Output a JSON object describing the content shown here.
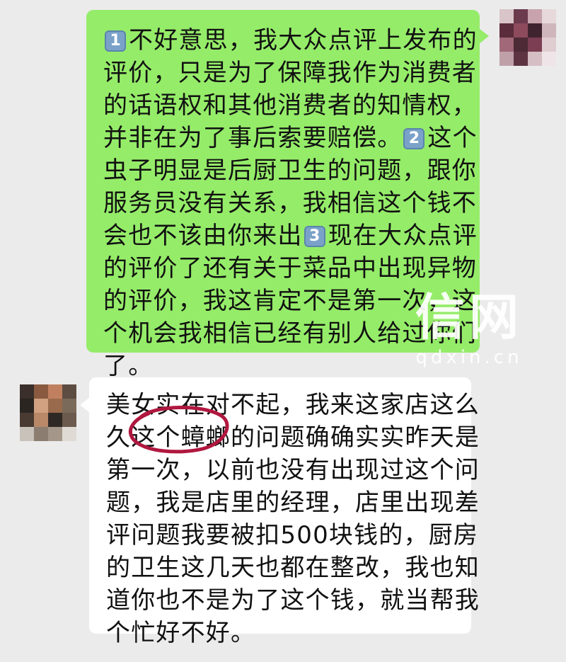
{
  "conversation": {
    "outgoing_message": {
      "lines": [
        {
          "badge": "1",
          "text": "不好意思，我大众点评上发布的"
        },
        {
          "text": "评价，只是为了保障我作为消费者"
        },
        {
          "text": "的话语权和其他消费者的知情权，"
        },
        {
          "text": "并非在为了事后索要赔偿。",
          "badge": "2",
          "after": "这个"
        },
        {
          "text": "虫子明显是后厨卫生的问题，跟你"
        },
        {
          "text": "服务员没有关系，我相信这个钱不"
        },
        {
          "text": "会也不该由你来出",
          "badge": "3",
          "after": "现在大众点评"
        },
        {
          "text": "的评价了还有关于菜品中出现异物"
        },
        {
          "text": "的评价，我这肯定不是第一次，这"
        },
        {
          "text": "个机会我相信已经有别人给过你们"
        },
        {
          "text": "了。"
        }
      ]
    },
    "incoming_message": {
      "lines": [
        {
          "text": "美女实在对不起，我来这家店这么"
        },
        {
          "text": "久这个",
          "circled": "蟑螂",
          "after": "的问题确确实实昨天是"
        },
        {
          "text": "第一次，以前也没有出现过这个问"
        },
        {
          "text": "题，我是店里的经理，店里出现差"
        },
        {
          "text": "评问题我要被扣500块钱的，厨房"
        },
        {
          "text": "的卫生这几天也都在整改，我也知"
        },
        {
          "text": "道你也不是为了这个钱，就当帮我"
        },
        {
          "text": "个忙好不好。"
        }
      ]
    }
  },
  "watermark": {
    "main": "信网",
    "sub": "qdxin.cn"
  },
  "colors": {
    "background": "#ebebeb",
    "outgoing_bubble": "#95ec69",
    "incoming_bubble": "#ffffff",
    "number_badge": "#7aa2c9",
    "annotation_circle": "#b0173f"
  },
  "icons": {
    "avatar_me": "pixelated-avatar",
    "avatar_other": "pixelated-avatar",
    "number_badge": "keycap-number-icon"
  }
}
